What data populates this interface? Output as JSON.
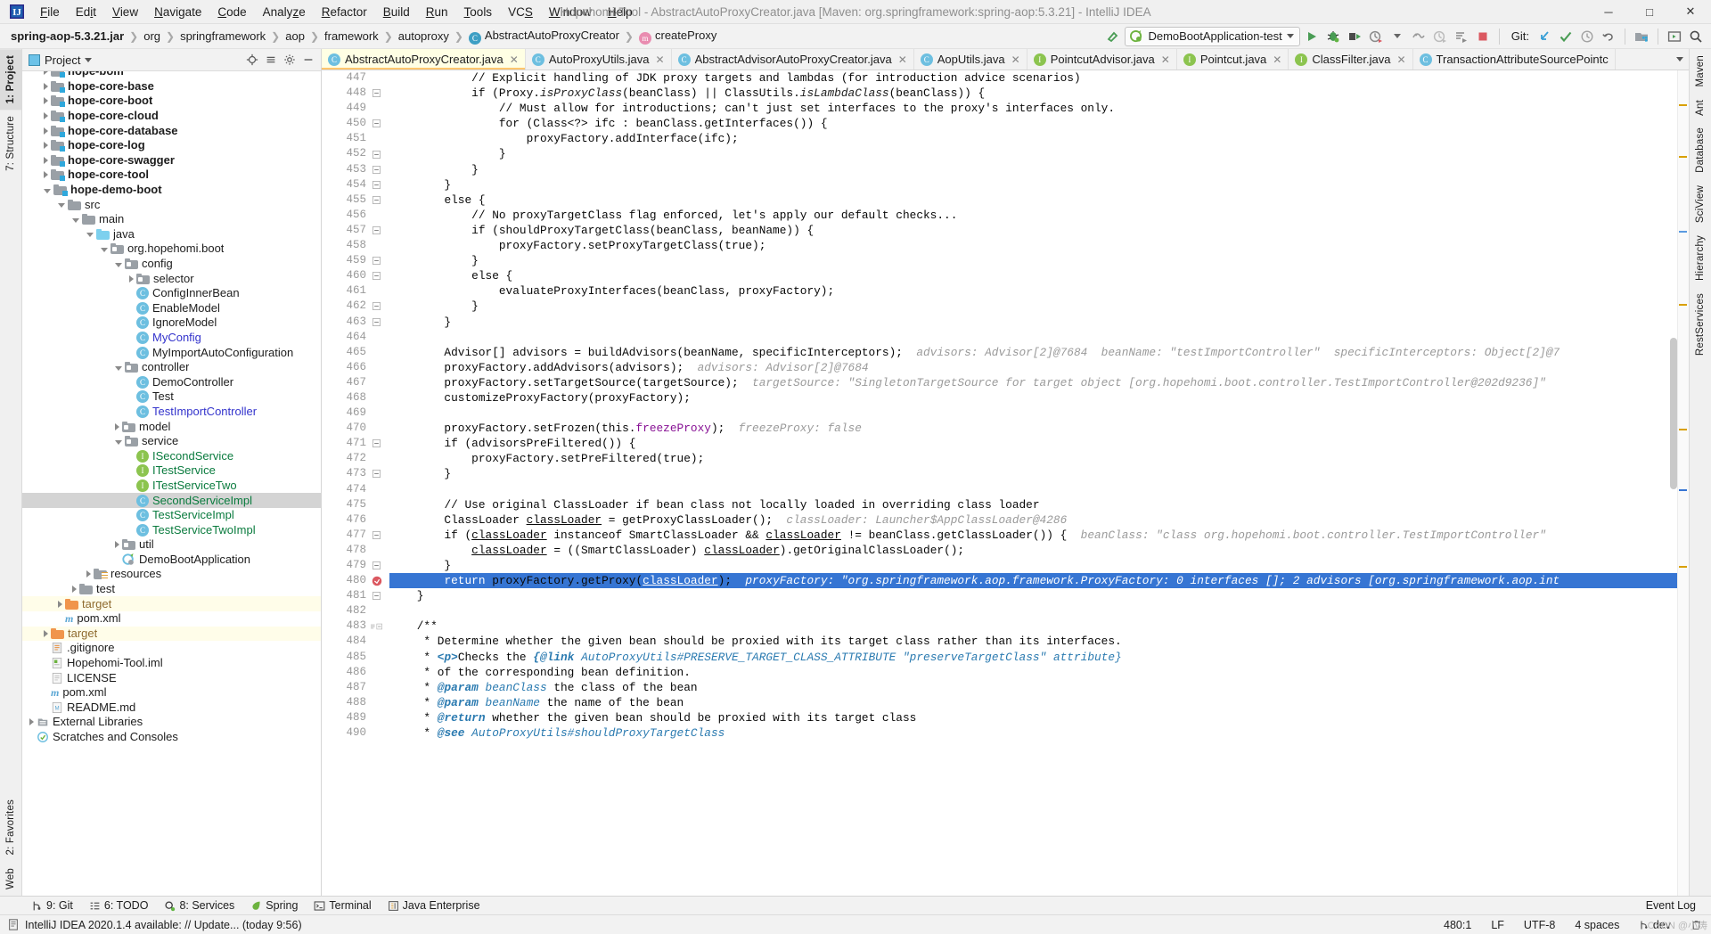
{
  "window": {
    "title": "Hopehomi-Tool - AbstractAutoProxyCreator.java [Maven: org.springframework:spring-aop:5.3.21] - IntelliJ IDEA",
    "minimize": "─",
    "maximize": "□",
    "close": "✕"
  },
  "menu": [
    {
      "label": "File",
      "name": "menu-file"
    },
    {
      "label": "Edit",
      "name": "menu-edit"
    },
    {
      "label": "View",
      "name": "menu-view"
    },
    {
      "label": "Navigate",
      "name": "menu-navigate"
    },
    {
      "label": "Code",
      "name": "menu-code"
    },
    {
      "label": "Analyze",
      "name": "menu-analyze"
    },
    {
      "label": "Refactor",
      "name": "menu-refactor"
    },
    {
      "label": "Build",
      "name": "menu-build"
    },
    {
      "label": "Run",
      "name": "menu-run"
    },
    {
      "label": "Tools",
      "name": "menu-tools"
    },
    {
      "label": "VCS",
      "name": "menu-vcs"
    },
    {
      "label": "Window",
      "name": "menu-window"
    },
    {
      "label": "Help",
      "name": "menu-help"
    }
  ],
  "breadcrumb": [
    {
      "label": "spring-aop-5.3.21.jar",
      "bold": true,
      "icon": ""
    },
    {
      "label": "org",
      "bold": false,
      "icon": ""
    },
    {
      "label": "springframework",
      "bold": false,
      "icon": ""
    },
    {
      "label": "aop",
      "bold": false,
      "icon": ""
    },
    {
      "label": "framework",
      "bold": false,
      "icon": ""
    },
    {
      "label": "autoproxy",
      "bold": false,
      "icon": ""
    },
    {
      "label": "AbstractAutoProxyCreator",
      "bold": false,
      "icon": "class"
    },
    {
      "label": "createProxy",
      "bold": false,
      "icon": "method"
    }
  ],
  "toolbar": {
    "run_config": "DemoBootApplication-test",
    "git_label": "Git:",
    "icons": [
      "build-icon",
      "run-icon",
      "debug-icon",
      "run-coverage-icon",
      "profile-icon",
      "stop-icon",
      "update-project-icon",
      "commit-icon",
      "history-icon",
      "rollback-icon",
      "select-opened-file-icon",
      "hide-windows-icon",
      "search-everywhere-icon"
    ]
  },
  "left_rail": [
    {
      "label": "1: Project",
      "active": true,
      "name": "rail-tab-project"
    },
    {
      "label": "7: Structure",
      "active": false,
      "name": "rail-tab-structure"
    },
    {
      "label": "2: Favorites",
      "active": false,
      "name": "rail-tab-favorites"
    },
    {
      "label": "Web",
      "active": false,
      "name": "rail-tab-web"
    }
  ],
  "right_rail": [
    {
      "label": "Maven",
      "name": "rail-tab-maven"
    },
    {
      "label": "Ant",
      "name": "rail-tab-ant"
    },
    {
      "label": "Database",
      "name": "rail-tab-database"
    },
    {
      "label": "SciView",
      "name": "rail-tab-sciview"
    },
    {
      "label": "Hierarchy",
      "name": "rail-tab-hierarchy"
    },
    {
      "label": "RestServices",
      "name": "rail-tab-restservices"
    }
  ],
  "project_panel": {
    "title": "Project",
    "tree": [
      {
        "indent": 1,
        "tw": "r",
        "icon": "module",
        "label": "hope-bom",
        "style": "b",
        "clip": true
      },
      {
        "indent": 1,
        "tw": "r",
        "icon": "module",
        "label": "hope-core-base",
        "style": "b"
      },
      {
        "indent": 1,
        "tw": "r",
        "icon": "module",
        "label": "hope-core-boot",
        "style": "b"
      },
      {
        "indent": 1,
        "tw": "r",
        "icon": "module",
        "label": "hope-core-cloud",
        "style": "b"
      },
      {
        "indent": 1,
        "tw": "r",
        "icon": "module",
        "label": "hope-core-database",
        "style": "b"
      },
      {
        "indent": 1,
        "tw": "r",
        "icon": "module",
        "label": "hope-core-log",
        "style": "b"
      },
      {
        "indent": 1,
        "tw": "r",
        "icon": "module",
        "label": "hope-core-swagger",
        "style": "b"
      },
      {
        "indent": 1,
        "tw": "r",
        "icon": "module",
        "label": "hope-core-tool",
        "style": "b"
      },
      {
        "indent": 1,
        "tw": "d",
        "icon": "module",
        "label": "hope-demo-boot",
        "style": "b"
      },
      {
        "indent": 2,
        "tw": "d",
        "icon": "folder",
        "label": "src"
      },
      {
        "indent": 3,
        "tw": "d",
        "icon": "folder",
        "label": "main"
      },
      {
        "indent": 4,
        "tw": "d",
        "icon": "source",
        "label": "java"
      },
      {
        "indent": 5,
        "tw": "d",
        "icon": "package",
        "label": "org.hopehomi.boot"
      },
      {
        "indent": 6,
        "tw": "d",
        "icon": "package",
        "label": "config"
      },
      {
        "indent": 7,
        "tw": "r",
        "icon": "package",
        "label": "selector"
      },
      {
        "indent": 7,
        "tw": "none",
        "icon": "class",
        "label": "ConfigInnerBean"
      },
      {
        "indent": 7,
        "tw": "none",
        "icon": "class",
        "label": "EnableModel"
      },
      {
        "indent": 7,
        "tw": "none",
        "icon": "class",
        "label": "IgnoreModel"
      },
      {
        "indent": 7,
        "tw": "none",
        "icon": "class",
        "label": "MyConfig",
        "style": "c-blue"
      },
      {
        "indent": 7,
        "tw": "none",
        "icon": "class",
        "label": "MyImportAutoConfiguration"
      },
      {
        "indent": 6,
        "tw": "d",
        "icon": "package",
        "label": "controller"
      },
      {
        "indent": 7,
        "tw": "none",
        "icon": "class",
        "label": "DemoController"
      },
      {
        "indent": 7,
        "tw": "none",
        "icon": "class",
        "label": "Test"
      },
      {
        "indent": 7,
        "tw": "none",
        "icon": "class",
        "label": "TestImportController",
        "style": "c-blue"
      },
      {
        "indent": 6,
        "tw": "r",
        "icon": "package",
        "label": "model"
      },
      {
        "indent": 6,
        "tw": "d",
        "icon": "package",
        "label": "service"
      },
      {
        "indent": 7,
        "tw": "none",
        "icon": "interface",
        "label": "ISecondService",
        "style": "c-green"
      },
      {
        "indent": 7,
        "tw": "none",
        "icon": "interface",
        "label": "ITestService",
        "style": "c-green"
      },
      {
        "indent": 7,
        "tw": "none",
        "icon": "interface",
        "label": "ITestServiceTwo",
        "style": "c-green"
      },
      {
        "indent": 7,
        "tw": "none",
        "icon": "class",
        "label": "SecondServiceImpl",
        "style": "c-green",
        "row": "sel"
      },
      {
        "indent": 7,
        "tw": "none",
        "icon": "class",
        "label": "TestServiceImpl",
        "style": "c-green"
      },
      {
        "indent": 7,
        "tw": "none",
        "icon": "class",
        "label": "TestServiceTwoImpl",
        "style": "c-green"
      },
      {
        "indent": 6,
        "tw": "r",
        "icon": "package",
        "label": "util"
      },
      {
        "indent": 6,
        "tw": "none",
        "icon": "spring",
        "label": "DemoBootApplication"
      },
      {
        "indent": 4,
        "tw": "r",
        "icon": "resources",
        "label": "resources"
      },
      {
        "indent": 3,
        "tw": "r",
        "icon": "folder",
        "label": "test"
      },
      {
        "indent": 2,
        "tw": "r",
        "icon": "target",
        "label": "target",
        "style": "c-brown",
        "row": "tgt"
      },
      {
        "indent": 2,
        "tw": "none",
        "icon": "maven",
        "label": "pom.xml"
      },
      {
        "indent": 1,
        "tw": "r",
        "icon": "target",
        "label": "target",
        "style": "c-brown",
        "row": "tgt"
      },
      {
        "indent": 1,
        "tw": "none",
        "icon": "git",
        "label": ".gitignore"
      },
      {
        "indent": 1,
        "tw": "none",
        "icon": "iml",
        "label": "Hopehomi-Tool.iml"
      },
      {
        "indent": 1,
        "tw": "none",
        "icon": "file",
        "label": "LICENSE"
      },
      {
        "indent": 1,
        "tw": "none",
        "icon": "maven",
        "label": "pom.xml"
      },
      {
        "indent": 1,
        "tw": "none",
        "icon": "md",
        "label": "README.md"
      },
      {
        "indent": 0,
        "tw": "r",
        "icon": "libs",
        "label": "External Libraries"
      },
      {
        "indent": 0,
        "tw": "none",
        "icon": "scratch",
        "label": "Scratches and Consoles"
      }
    ]
  },
  "editor_tabs": [
    {
      "label": "AbstractAutoProxyCreator.java",
      "icon": "class",
      "active": true,
      "closable": true
    },
    {
      "label": "AutoProxyUtils.java",
      "icon": "class",
      "active": false,
      "closable": true
    },
    {
      "label": "AbstractAdvisorAutoProxyCreator.java",
      "icon": "class",
      "active": false,
      "closable": true
    },
    {
      "label": "AopUtils.java",
      "icon": "class",
      "active": false,
      "closable": true
    },
    {
      "label": "PointcutAdvisor.java",
      "icon": "interface",
      "active": false,
      "closable": true
    },
    {
      "label": "Pointcut.java",
      "icon": "interface",
      "active": false,
      "closable": true
    },
    {
      "label": "ClassFilter.java",
      "icon": "interface",
      "active": false,
      "closable": true
    },
    {
      "label": "TransactionAttributeSourcePointc",
      "icon": "class",
      "active": false,
      "closable": false
    }
  ],
  "code": {
    "first_line": 447,
    "highlight_line": 480,
    "breakpoint_line": 480,
    "lines": [
      {
        "n": 447,
        "html": "            <cm>// Explicit handling of JDK proxy targets and lambdas (for introduction advice scenarios)</cm>"
      },
      {
        "n": 448,
        "html": "            <kw>if</kw> (Proxy.<i class=\"stat\">isProxyClass</i>(beanClass) || ClassUtils.<i class=\"stat\">isLambdaClass</i>(beanClass)) {",
        "mark": "fold"
      },
      {
        "n": 449,
        "html": "                <cm>// Must allow for introductions; can't just set interfaces to the proxy's interfaces only.</cm>"
      },
      {
        "n": 450,
        "html": "                <kw>for</kw> (Class&lt;?&gt; ifc : beanClass.getInterfaces()) {",
        "mark": "fold"
      },
      {
        "n": 451,
        "html": "                    proxyFactory.addInterface(ifc);"
      },
      {
        "n": 452,
        "html": "                }",
        "mark": "fold"
      },
      {
        "n": 453,
        "html": "            }",
        "mark": "fold"
      },
      {
        "n": 454,
        "html": "        }",
        "mark": "fold"
      },
      {
        "n": 455,
        "html": "        <kw>else</kw> {",
        "mark": "fold"
      },
      {
        "n": 456,
        "html": "            <cm>// No proxyTargetClass flag enforced, let's apply our default checks...</cm>"
      },
      {
        "n": 457,
        "html": "            <kw>if</kw> (shouldProxyTargetClass(beanClass, beanName)) {",
        "mark": "fold"
      },
      {
        "n": 458,
        "html": "                proxyFactory.setProxyTargetClass(<kw>true</kw>);"
      },
      {
        "n": 459,
        "html": "            }",
        "mark": "fold"
      },
      {
        "n": 460,
        "html": "            <kw>else</kw> {",
        "mark": "fold"
      },
      {
        "n": 461,
        "html": "                evaluateProxyInterfaces(beanClass, proxyFactory);"
      },
      {
        "n": 462,
        "html": "            }",
        "mark": "fold"
      },
      {
        "n": 463,
        "html": "        }",
        "mark": "fold"
      },
      {
        "n": 464,
        "html": ""
      },
      {
        "n": 465,
        "html": "        Advisor[] advisors = buildAdvisors(beanName, specificInterceptors);  <span class=\"hint\">advisors: Advisor[2]@7684  beanName: \"testImportController\"  specificInterceptors: Object[2]@7</span>"
      },
      {
        "n": 466,
        "html": "        proxyFactory.addAdvisors(advisors);  <span class=\"hint\">advisors: Advisor[2]@7684</span>"
      },
      {
        "n": 467,
        "html": "        proxyFactory.setTargetSource(targetSource);  <span class=\"hint\">targetSource: \"SingletonTargetSource for target object [org.hopehomi.boot.controller.TestImportController@202d9236]\"</span>"
      },
      {
        "n": 468,
        "html": "        customizeProxyFactory(proxyFactory);"
      },
      {
        "n": 469,
        "html": ""
      },
      {
        "n": 470,
        "html": "        proxyFactory.setFrozen(<kw>this</kw>.<span class=\"fld\">freezeProxy</span>);  <span class=\"hint\">freezeProxy: false</span>"
      },
      {
        "n": 471,
        "html": "        <kw>if</kw> (advisorsPreFiltered()) {",
        "mark": "fold"
      },
      {
        "n": 472,
        "html": "            proxyFactory.setPreFiltered(<kw>true</kw>);"
      },
      {
        "n": 473,
        "html": "        }",
        "mark": "fold"
      },
      {
        "n": 474,
        "html": ""
      },
      {
        "n": 475,
        "html": "        <cm>// Use original ClassLoader if bean class not locally loaded in overriding class loader</cm>"
      },
      {
        "n": 476,
        "html": "        ClassLoader <span class=\"un\">classLoader</span> = getProxyClassLoader();  <span class=\"hint\">classLoader: Launcher$AppClassLoader@4286</span>"
      },
      {
        "n": 477,
        "html": "        <kw>if</kw> (<span class=\"un\">classLoader</span> <kw>instanceof</kw> SmartClassLoader &amp;&amp; <span class=\"un\">classLoader</span> != beanClass.getClassLoader()) {  <span class=\"hint\">beanClass: \"class org.hopehomi.boot.controller.TestImportController\"</span>",
        "mark": "fold"
      },
      {
        "n": 478,
        "html": "            <span class=\"un\">classLoader</span> = ((SmartClassLoader) <span class=\"un\">classLoader</span>).getOriginalClassLoader();"
      },
      {
        "n": 479,
        "html": "        }",
        "mark": "fold"
      },
      {
        "n": 480,
        "html": "        <kw>return</kw> proxyFactory.getProxy(<span class=\"un\">classLoader</span>);  <span class=\"hint\">proxyFactory: \"org.springframework.aop.framework.ProxyFactory: 0 interfaces []; 2 advisors [org.springframework.aop.int</span>",
        "hl": true
      },
      {
        "n": 481,
        "html": "    }",
        "mark": "fold"
      },
      {
        "n": 482,
        "html": ""
      },
      {
        "n": 483,
        "html": "    <jd>/**</jd>",
        "mark": "fold2"
      },
      {
        "n": 484,
        "html": "     <jd>* Determine whether the given bean should be proxied with its target class rather than its interfaces.</jd>"
      },
      {
        "n": 485,
        "html": "     <jd>* <i class=\"jdt\">&lt;p&gt;</i>Checks the <i class=\"jdt\">{@link</i> <i class=\"jdl\">AutoProxyUtils#PRESERVE_TARGET_CLASS_ATTRIBUTE \"preserveTargetClass\" attribute}</i></jd>"
      },
      {
        "n": 486,
        "html": "     <jd>* of the corresponding bean definition.</jd>"
      },
      {
        "n": 487,
        "html": "     <jd>* <i class=\"jdt\">@param</i> <i class=\"jdl\">beanClass</i> the class of the bean</jd>"
      },
      {
        "n": 488,
        "html": "     <jd>* <i class=\"jdt\">@param</i> <i class=\"jdl\">beanName</i> the name of the bean</jd>"
      },
      {
        "n": 489,
        "html": "     <jd>* <i class=\"jdt\">@return</i> whether the given bean should be proxied with its target class</jd>"
      },
      {
        "n": 490,
        "html": "     <jd>* <i class=\"jdt\">@see</i> <i class=\"jdl\">AutoProxyUtils#shouldProxyTargetClass</i></jd>"
      }
    ]
  },
  "bottom_bar": [
    {
      "label": "9: Git",
      "icon": "git-icon",
      "name": "tool-git"
    },
    {
      "label": "6: TODO",
      "icon": "todo-icon",
      "name": "tool-todo"
    },
    {
      "label": "8: Services",
      "icon": "services-icon",
      "name": "tool-services"
    },
    {
      "label": "Spring",
      "icon": "spring-icon",
      "name": "tool-spring"
    },
    {
      "label": "Terminal",
      "icon": "terminal-icon",
      "name": "tool-terminal"
    },
    {
      "label": "Java Enterprise",
      "icon": "jee-icon",
      "name": "tool-java-enterprise"
    }
  ],
  "bottom_right": {
    "event_log": "Event Log"
  },
  "status": {
    "message": "IntelliJ IDEA 2020.1.4 available: // Update... (today 9:56)",
    "caret": "480:1",
    "line_sep": "LF",
    "encoding": "UTF-8",
    "indent": "4 spaces",
    "branch": "dev"
  },
  "colors": {
    "accent": "#3675d3",
    "tab_active_bg": "#ffffe4",
    "tab_underline": "#ffc66d",
    "keyword": "#0033b3",
    "string": "#067d17",
    "comment": "#8c8c8c",
    "hint": "#9a9a9a",
    "target_row": "#fffde9",
    "selection": "#d4d4d4",
    "green_file": "#0a7b3e",
    "blue_file": "#3333cc"
  },
  "watermark": "CSDN @小涛"
}
